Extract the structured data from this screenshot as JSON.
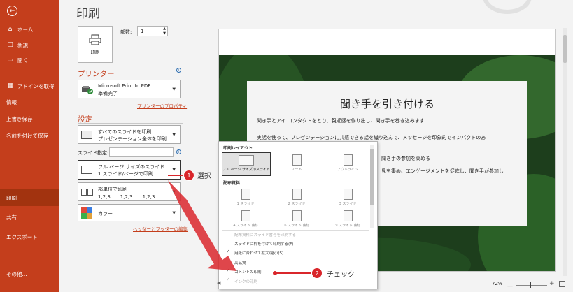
{
  "sidebar": {
    "items": [
      {
        "label": "ホーム",
        "icon": "home-icon"
      },
      {
        "label": "新規",
        "icon": "new-file-icon"
      },
      {
        "label": "開く",
        "icon": "open-folder-icon"
      },
      {
        "label": "アドインを取得",
        "icon": "addin-icon"
      },
      {
        "label": "情報"
      },
      {
        "label": "上書き保存"
      },
      {
        "label": "名前を付けて保存"
      },
      {
        "label": "印刷"
      },
      {
        "label": "共有"
      },
      {
        "label": "エクスポート"
      },
      {
        "label": "その他..."
      }
    ],
    "selected": "印刷"
  },
  "page_title": "印刷",
  "print_button": {
    "label": "印刷"
  },
  "copies": {
    "label": "部数:",
    "value": "1"
  },
  "printer": {
    "heading": "プリンター",
    "name": "Microsoft Print to PDF",
    "status": "準備完了",
    "properties_link": "プリンターのプロパティ"
  },
  "settings": {
    "heading": "設定",
    "range": {
      "line1": "すべてのスライドを印刷",
      "line2": "プレゼンテーション全体を印刷..."
    },
    "slides_label": "スライド指定:",
    "layout": {
      "line1": "フル ページ サイズのスライド",
      "line2": "1 スライド/ページで印刷"
    },
    "collate": {
      "line1": "部単位で印刷",
      "line2": "1,2,3　　1,2,3　　1,2,3"
    },
    "color": {
      "line1": "カラー"
    },
    "header_footer_link": "ヘッダーとフッターの編集"
  },
  "slide": {
    "title": "聞き手を引き付ける",
    "lines": [
      "聞き手とアイ コンタクトをとり、親近感を作り出し、聞き手を巻き込みます",
      "実話を使って、プレゼンテーションに共感できる話を織り込んで、メッセージを印象的でインパクトのあ",
      "聞き手の参加を高める",
      "見を集め、エンゲージメントを促進し、聞き手が参加し"
    ]
  },
  "layout_popup": {
    "section1": "印刷レイアウト",
    "layouts": [
      {
        "label": "フル ページ サイズのスライド",
        "selected": true
      },
      {
        "label": "ノート",
        "selected": false
      },
      {
        "label": "アウトライン",
        "selected": false
      }
    ],
    "section2": "配布資料",
    "handouts": [
      {
        "label": "1 スライド"
      },
      {
        "label": "2 スライド"
      },
      {
        "label": "3 スライド"
      },
      {
        "label": "4 スライド (横)"
      },
      {
        "label": "6 スライド (横)"
      },
      {
        "label": "9 スライド (横)"
      }
    ],
    "options": [
      {
        "label": "配布資料にスライド番号を印刷する",
        "checked": false,
        "disabled": true
      },
      {
        "label": "スライドに枠を付けて印刷する(F)",
        "checked": false,
        "disabled": false
      },
      {
        "label": "用紙に合わせて拡大/縮小(S)",
        "checked": true,
        "disabled": false
      },
      {
        "label": "高品質",
        "checked": false,
        "disabled": false
      },
      {
        "label": "コメントの印刷",
        "checked": true,
        "disabled": false
      },
      {
        "label": "インクの印刷",
        "checked": true,
        "disabled": true
      }
    ]
  },
  "annotations": {
    "callout1": {
      "number": "1",
      "text": "選択"
    },
    "callout2": {
      "number": "2",
      "text": "チェック"
    }
  },
  "zoom": {
    "value": "72%"
  },
  "colors": {
    "accent": "#c43e1c",
    "callout_red": "#d9262b",
    "slide_bg": "#1d3e1c"
  }
}
